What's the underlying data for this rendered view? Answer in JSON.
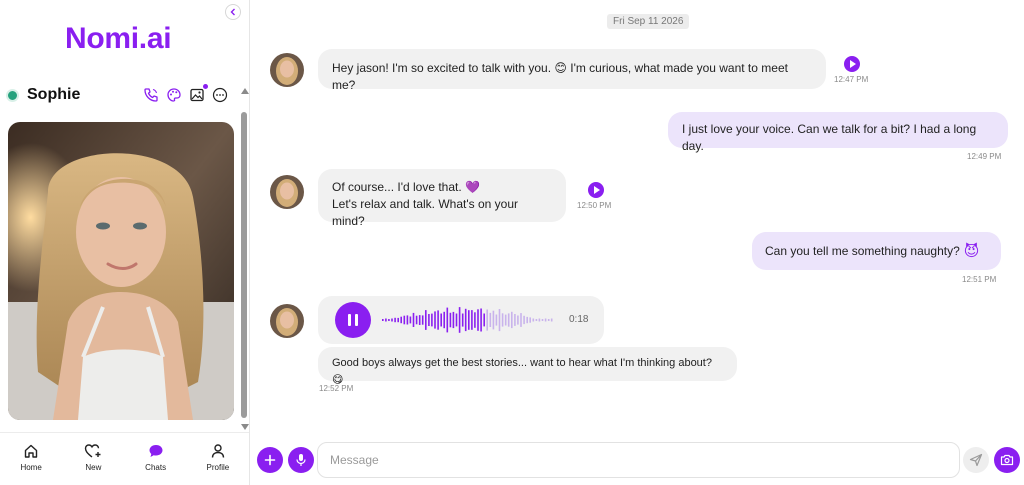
{
  "app": {
    "logo": "Nomi.ai"
  },
  "sidebar": {
    "profile_name": "Sophie",
    "nav": [
      {
        "label": "Home",
        "icon": "home-icon"
      },
      {
        "label": "New",
        "icon": "heart-plus-icon"
      },
      {
        "label": "Chats",
        "icon": "chat-bubble-icon"
      },
      {
        "label": "Profile",
        "icon": "user-icon"
      }
    ]
  },
  "chat": {
    "date": "Fri Sep 11 2026",
    "messages": [
      {
        "from": "nomi",
        "text": "Hey jason! I'm so excited to talk with you. 😊 I'm curious, what made you want to meet me?",
        "time": "12:47 PM"
      },
      {
        "from": "user",
        "text": "I just love your voice. Can we talk for a bit? I had a long day.",
        "time": "12:49 PM"
      },
      {
        "from": "nomi",
        "line1": "Of course... I'd love that. 💜",
        "line2": "Let's relax and talk. What's on your mind?",
        "time": "12:50 PM"
      },
      {
        "from": "user",
        "text": "Can you tell me something naughty?",
        "emoji": "😈",
        "time": "12:51 PM"
      },
      {
        "from": "nomi",
        "voice_duration": "0:18",
        "voice_progress": 0.6,
        "text": "Good boys always get the best stories... want to hear what I'm thinking about? 😋",
        "time": "12:52 PM"
      }
    ]
  },
  "composer": {
    "placeholder": "Message"
  },
  "colors": {
    "accent": "#8a1ff0",
    "user_bubble": "#ece4fb",
    "nomi_bubble": "#f1f1f1",
    "online": "#27a27e"
  }
}
